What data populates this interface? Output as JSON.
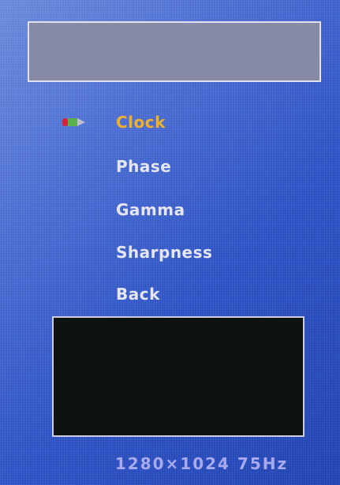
{
  "osd": {
    "menu": {
      "items": [
        {
          "label": "Clock",
          "selected": true
        },
        {
          "label": "Phase",
          "selected": false
        },
        {
          "label": "Gamma",
          "selected": false
        },
        {
          "label": "Sharpness",
          "selected": false
        },
        {
          "label": "Back",
          "selected": false
        }
      ],
      "selector_icon": "colored-pointer-icon"
    },
    "status": {
      "resolution": "1280×1024  75Hz"
    },
    "colors": {
      "background": "#3a60d0",
      "selected_text": "#f0b22c",
      "normal_text": "#e6e6f2",
      "title_panel": "#878aa4",
      "info_panel": "#0f1212",
      "status_text": "#a8a9ef"
    }
  }
}
